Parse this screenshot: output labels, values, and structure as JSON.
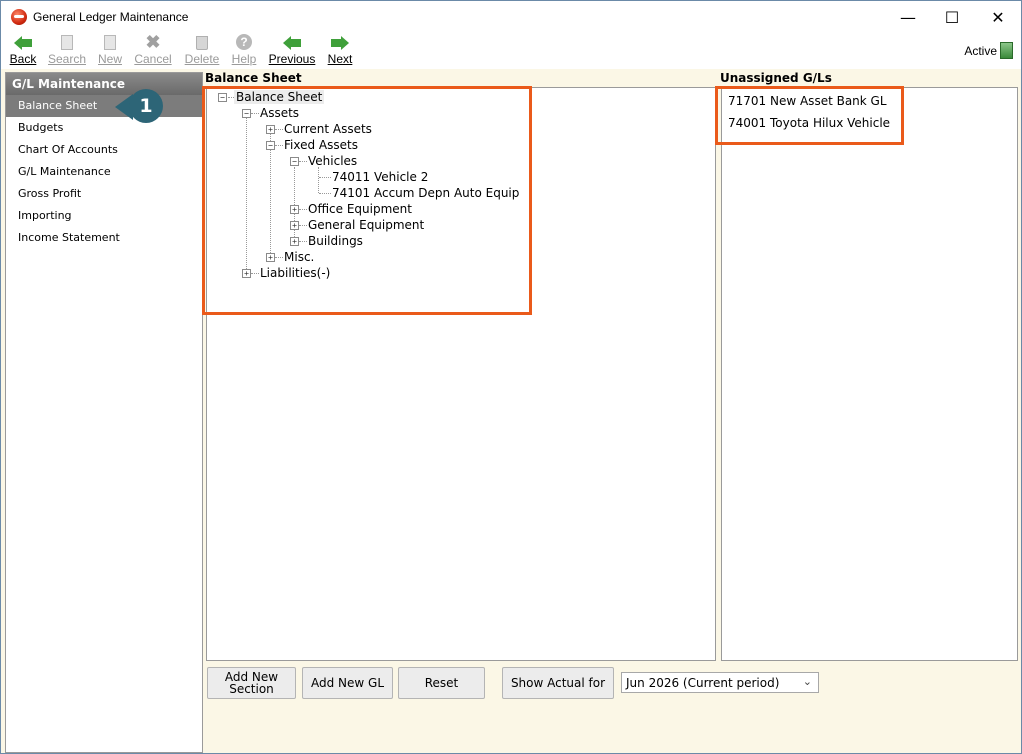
{
  "window": {
    "title": "General Ledger Maintenance",
    "minimize": "—",
    "maximize": "☐",
    "close": "✕"
  },
  "toolbar": {
    "back": "Back",
    "search": "Search",
    "new": "New",
    "cancel": "Cancel",
    "delete": "Delete",
    "help": "Help",
    "previous": "Previous",
    "next": "Next",
    "status": "Active"
  },
  "sidebar": {
    "header": "G/L Maintenance",
    "items": [
      "Balance Sheet",
      "Budgets",
      "Chart Of Accounts",
      "G/L Maintenance",
      "Gross Profit",
      "Importing",
      "Income Statement"
    ]
  },
  "callout": "1",
  "balance_sheet": {
    "title": "Balance Sheet",
    "tree": {
      "root": "Balance Sheet",
      "assets": "Assets",
      "current_assets": "Current Assets",
      "fixed_assets": "Fixed Assets",
      "vehicles": "Vehicles",
      "vehicle_2": "74011 Vehicle 2",
      "accum_depn": "74101 Accum Depn Auto Equip",
      "office_equipment": "Office Equipment",
      "general_equipment": "General Equipment",
      "buildings": "Buildings",
      "misc": "Misc.",
      "liabilities": "Liabilities(-)"
    }
  },
  "unassigned": {
    "title": "Unassigned G/Ls",
    "items": [
      "71701 New Asset Bank GL",
      "74001 Toyota Hilux Vehicle"
    ]
  },
  "buttons": {
    "add_section_line1": "Add New",
    "add_section_line2": "Section",
    "add_gl": "Add New GL",
    "reset": "Reset",
    "show_actual": "Show Actual for"
  },
  "period_select": {
    "value": "Jun 2026 (Current period)"
  },
  "colors": {
    "highlight": "#ea5a1a",
    "callout": "#2d6577",
    "selected_nav": "#7c7c7c"
  }
}
